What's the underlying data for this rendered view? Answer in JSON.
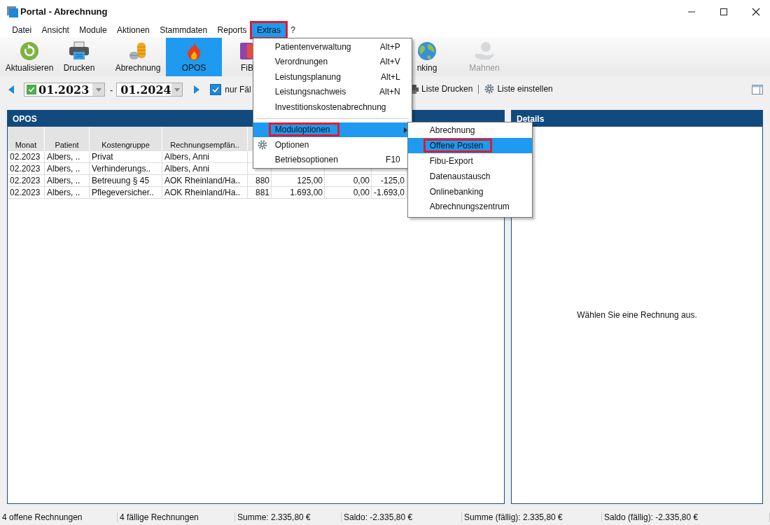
{
  "window": {
    "title": "Portal - Abrechnung"
  },
  "menu_bar": [
    {
      "label": "Datei",
      "selected": false,
      "highlighted": false
    },
    {
      "label": "Ansicht",
      "selected": false,
      "highlighted": false
    },
    {
      "label": "Module",
      "selected": false,
      "highlighted": false
    },
    {
      "label": "Aktionen",
      "selected": false,
      "highlighted": false
    },
    {
      "label": "Stammdaten",
      "selected": false,
      "highlighted": false
    },
    {
      "label": "Reports",
      "selected": false,
      "highlighted": false
    },
    {
      "label": "Extras",
      "selected": true,
      "highlighted": true
    },
    {
      "label": "?",
      "selected": false,
      "highlighted": false
    }
  ],
  "toolbar": [
    {
      "kind": "refresh",
      "label": "Aktualisieren",
      "selected": false,
      "disabled": false
    },
    {
      "kind": "printer",
      "label": "Drucken",
      "selected": false,
      "disabled": false
    },
    {
      "kind": "coins",
      "label": "Abrechnung",
      "selected": false,
      "disabled": false
    },
    {
      "kind": "flame",
      "label": "OPOS",
      "selected": true,
      "disabled": false
    },
    {
      "kind": "book",
      "label": "FiB",
      "selected": false,
      "disabled": false
    },
    {
      "kind": "globe",
      "label": "nking",
      "selected": false,
      "disabled": false
    },
    {
      "kind": "hand",
      "label": "Mahnen",
      "selected": false,
      "disabled": true
    }
  ],
  "period": {
    "from_checked": true,
    "from": "01.2023",
    "separator": "-",
    "to": "01.2024"
  },
  "filter": {
    "label": "nur Fäl",
    "checked": true
  },
  "list_actions": [
    {
      "kind": "printer",
      "label": "Liste Drucken"
    },
    {
      "kind": "gear",
      "label": "Liste einstellen"
    }
  ],
  "opos": {
    "title": "OPOS",
    "columns": [
      "Monat",
      "Patient",
      "Kostengruppe",
      "Rechnungsempfän.."
    ],
    "rows": [
      {
        "cells": [
          "02.2023",
          "Albers, ..",
          "Privat",
          "Albers, Anni"
        ]
      },
      {
        "cells": [
          "02.2023",
          "Albers, ..",
          "Verhinderungs..",
          "Albers, Anni"
        ]
      },
      {
        "cells": [
          "02.2023",
          "Albers, ..",
          "Betreuung § 45",
          "AOK Rheinland/Ha..",
          "880",
          "125,00",
          "0,00",
          "-125,0"
        ]
      },
      {
        "cells": [
          "02.2023",
          "Albers, ..",
          "Pflegeversicher..",
          "AOK Rheinland/Ha..",
          "881",
          "1.693,00",
          "0,00",
          "-1.693,0"
        ]
      }
    ]
  },
  "details": {
    "title": "Details",
    "message": "Wählen Sie eine Rechnung aus."
  },
  "extras_menu": [
    {
      "label": "Patientenverwaltung",
      "shortcut": "Alt+P",
      "kind": "item",
      "selected": false,
      "highlighted": false
    },
    {
      "label": "Verordnungen",
      "shortcut": "Alt+V",
      "kind": "item",
      "selected": false,
      "highlighted": false
    },
    {
      "label": "Leistungsplanung",
      "shortcut": "Alt+L",
      "kind": "item",
      "selected": false,
      "highlighted": false
    },
    {
      "label": "Leistungsnachweis",
      "shortcut": "Alt+N",
      "kind": "item",
      "selected": false,
      "highlighted": false
    },
    {
      "label": "Investitionskostenabrechnung",
      "kind": "item",
      "selected": false,
      "highlighted": false
    },
    {
      "kind": "separator"
    },
    {
      "label": "Moduloptionen",
      "kind": "submenu",
      "selected": true,
      "highlighted": true
    },
    {
      "label": "Optionen",
      "kind": "gear",
      "selected": false,
      "highlighted": false
    },
    {
      "label": "Betriebsoptionen",
      "shortcut": "F10",
      "kind": "item",
      "selected": false,
      "highlighted": false
    }
  ],
  "submenu": [
    {
      "label": "Abrechnung",
      "selected": false,
      "highlighted": false
    },
    {
      "label": "Offene Posten",
      "selected": true,
      "highlighted": true
    },
    {
      "label": "Fibu-Export",
      "selected": false,
      "highlighted": false
    },
    {
      "label": "Datenaustausch",
      "selected": false,
      "highlighted": false
    },
    {
      "label": "Onlinebanking",
      "selected": false,
      "highlighted": false
    },
    {
      "label": "Abrechnungszentrum",
      "selected": false,
      "highlighted": false
    }
  ],
  "status_bar": [
    "4 offene Rechnungen",
    "4 fällige Rechnungen",
    "Summe: 2.335,80 €",
    "Saldo: -2.335,80 €",
    "Summe (fällig): 2.335,80 €",
    "Saldo (fällig): -2.335,80 €"
  ]
}
